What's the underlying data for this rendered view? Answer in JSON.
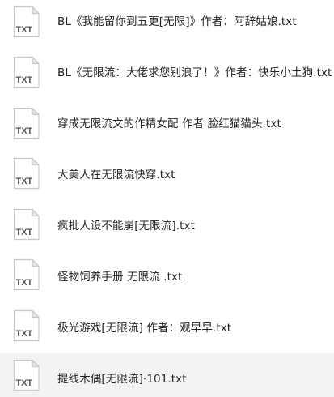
{
  "files": [
    {
      "name": "BL《我能留你到五更[无限]》作者：阿辞姑娘.txt",
      "icon": "txt-file-icon",
      "icon_label": "TXT",
      "selected": false
    },
    {
      "name": "BL《无限流：大佬求您别浪了！》作者：快乐小土狗.txt",
      "icon": "txt-file-icon",
      "icon_label": "TXT",
      "selected": false
    },
    {
      "name": "穿成无限流文的作精女配 作者 脸红猫猫头.txt",
      "icon": "txt-file-icon",
      "icon_label": "TXT",
      "selected": false
    },
    {
      "name": "大美人在无限流快穿.txt",
      "icon": "txt-file-icon",
      "icon_label": "TXT",
      "selected": false
    },
    {
      "name": "疯批人设不能崩[无限流].txt",
      "icon": "txt-file-icon",
      "icon_label": "TXT",
      "selected": false
    },
    {
      "name": "怪物饲养手册 无限流 .txt",
      "icon": "txt-file-icon",
      "icon_label": "TXT",
      "selected": false
    },
    {
      "name": "极光游戏[无限流] 作者：观早早.txt",
      "icon": "txt-file-icon",
      "icon_label": "TXT",
      "selected": false
    },
    {
      "name": "提线木偶[无限流]·101.txt",
      "icon": "txt-file-icon",
      "icon_label": "TXT",
      "selected": true
    }
  ],
  "colors": {
    "selected_row": "#f3f3f3",
    "icon_border": "#c8c8c8",
    "icon_fold": "#e6e6e6",
    "icon_text": "#555555",
    "text": "#222222"
  }
}
